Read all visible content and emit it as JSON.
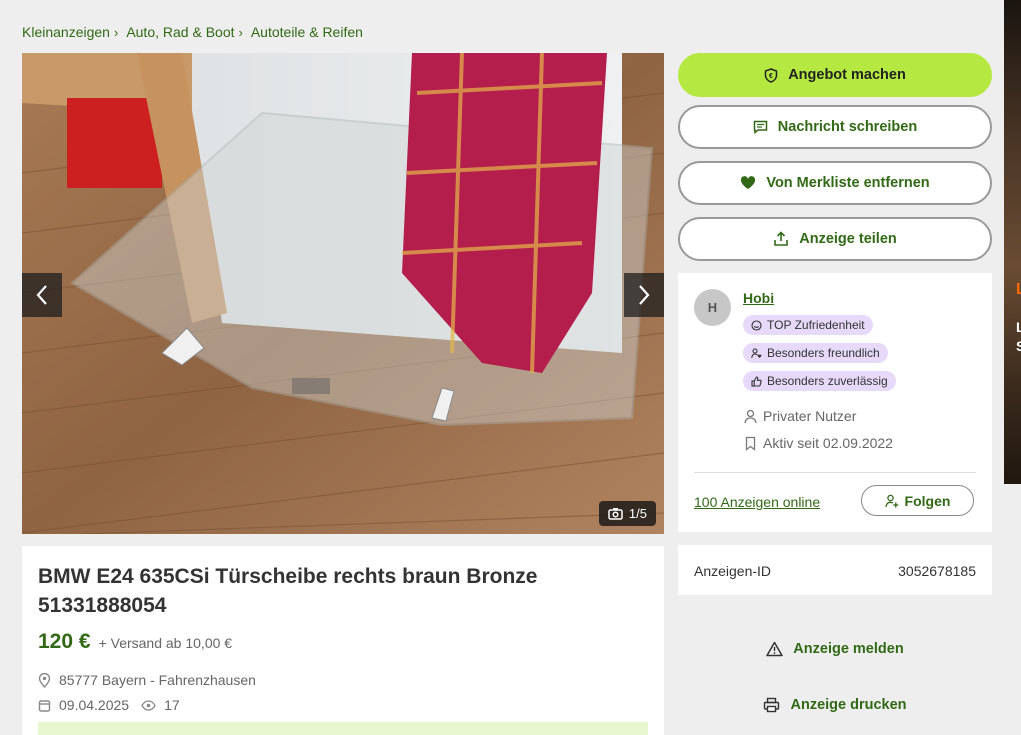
{
  "breadcrumb": [
    {
      "label": "Kleinanzeigen"
    },
    {
      "label": "Auto, Rad & Boot"
    },
    {
      "label": "Autoteile & Reifen"
    }
  ],
  "gallery": {
    "counter": "1/5",
    "current": 1,
    "total": 5
  },
  "listing": {
    "title": "BMW E24 635CSi Türscheibe rechts braun Bronze 51331888054",
    "price": "120 €",
    "shipping": "+ Versand ab 10,00 €",
    "location": "85777 Bayern - Fahrenzhausen",
    "date": "09.04.2025",
    "views": "17"
  },
  "actions": {
    "offer": "Angebot machen",
    "message": "Nachricht schreiben",
    "watchlist": "Von Merkliste entfernen",
    "share": "Anzeige teilen",
    "report": "Anzeige melden",
    "print": "Anzeige drucken"
  },
  "seller": {
    "initial": "H",
    "name": "Hobi",
    "badges": [
      "TOP Zufriedenheit",
      "Besonders freundlich",
      "Besonders zuverlässig"
    ],
    "type": "Privater Nutzer",
    "active_since": "Aktiv seit 02.09.2022",
    "online_count": "100 Anzeigen online",
    "follow_label": "Folgen"
  },
  "ad_id": {
    "label": "Anzeigen-ID",
    "value": "3052678185"
  },
  "side_ad": {
    "line1": "L",
    "line2": "L",
    "line3": "S"
  },
  "colors": {
    "brand_green": "#326916",
    "accent_lime": "#b5e941",
    "badge_purple": "#e6d9fa"
  },
  "icons": [
    "chevron-right-icon",
    "camera-icon",
    "shield-euro-icon",
    "message-icon",
    "heart-icon",
    "share-icon",
    "location-pin-icon",
    "calendar-icon",
    "eye-icon",
    "smiley-icon",
    "person-heart-icon",
    "thumbs-up-icon",
    "user-icon",
    "bookmark-icon",
    "person-plus-icon",
    "warning-icon",
    "printer-icon"
  ]
}
